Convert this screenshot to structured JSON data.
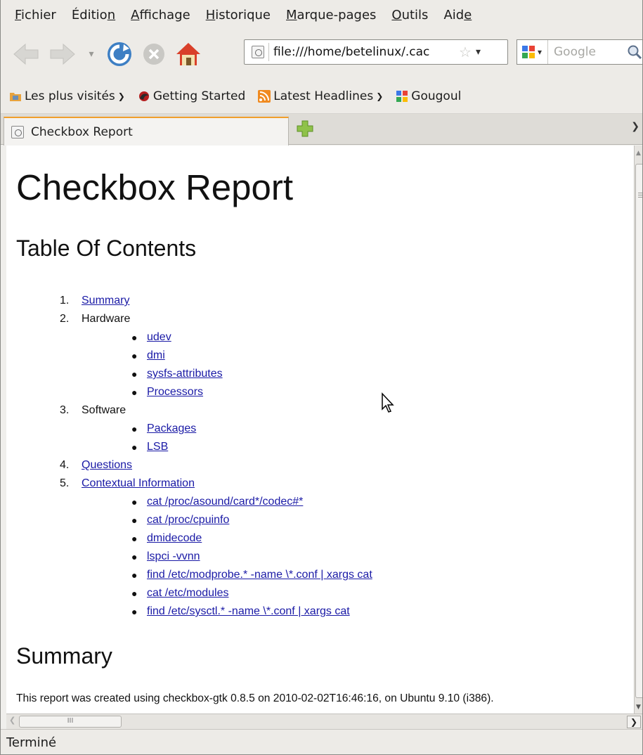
{
  "menubar": {
    "items": [
      {
        "mnemonic": "F",
        "rest": "ichier"
      },
      {
        "pre": "Éditio",
        "mnemonic": "n",
        "rest": ""
      },
      {
        "mnemonic": "A",
        "rest": "ffichage"
      },
      {
        "mnemonic": "H",
        "rest": "istorique"
      },
      {
        "mnemonic": "M",
        "rest": "arque-pages"
      },
      {
        "mnemonic": "O",
        "rest": "utils"
      },
      {
        "pre": "Aid",
        "mnemonic": "e",
        "rest": ""
      }
    ]
  },
  "navbar": {
    "url": "file:///home/betelinux/.cac",
    "search_placeholder": "Google",
    "icons": [
      "back-arrow-icon",
      "forward-arrow-icon",
      "reload-icon",
      "stop-icon",
      "home-icon",
      "star-icon",
      "google-icon",
      "magnifier-icon"
    ]
  },
  "bookmarks": {
    "items": [
      {
        "label": "Les plus visités",
        "has_menu": true,
        "icon": "smart-folder-icon"
      },
      {
        "label": "Getting Started",
        "has_menu": false,
        "icon": "firefox-icon"
      },
      {
        "label": "Latest Headlines",
        "has_menu": true,
        "icon": "rss-icon"
      },
      {
        "label": "Gougoul",
        "has_menu": false,
        "icon": "google-icon"
      }
    ]
  },
  "tabs": {
    "active": "Checkbox Report"
  },
  "page": {
    "title": "Checkbox Report",
    "toc_heading": "Table Of Contents",
    "toc": [
      {
        "n": "1.",
        "label": "Summary",
        "link": true,
        "children": []
      },
      {
        "n": "2.",
        "label": "Hardware",
        "link": false,
        "children": [
          "udev",
          "dmi",
          "sysfs-attributes",
          "Processors"
        ]
      },
      {
        "n": "3.",
        "label": "Software",
        "link": false,
        "children": [
          "Packages",
          "LSB"
        ]
      },
      {
        "n": "4.",
        "label": "Questions",
        "link": true,
        "children": []
      },
      {
        "n": "5.",
        "label": "Contextual Information",
        "link": true,
        "children": [
          "cat /proc/asound/card*/codec#*",
          "cat /proc/cpuinfo",
          "dmidecode",
          "lspci -vvnn",
          "find /etc/modprobe.* -name \\*.conf | xargs cat",
          "cat /etc/modules",
          "find /etc/sysctl.* -name \\*.conf | xargs cat"
        ]
      }
    ],
    "summary_heading": "Summary",
    "summary_text": "This report was created using checkbox-gtk 0.8.5 on 2010-02-02T16:46:16, on Ubuntu 9.10 (i386)."
  },
  "statusbar": {
    "text": "Terminé"
  },
  "colors": {
    "link": "#1a1aa6",
    "tab_accent": "#f09e2c",
    "chrome": "#edebe7"
  }
}
